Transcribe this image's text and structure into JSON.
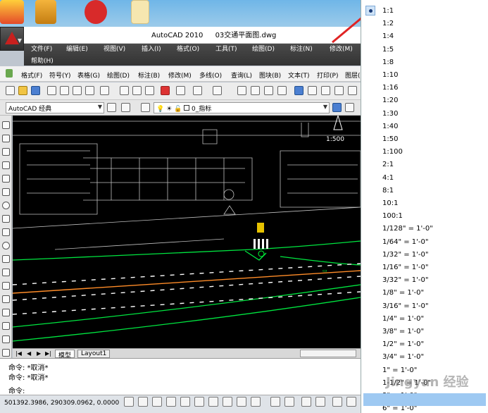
{
  "window": {
    "title": "AutoCAD 2010",
    "document": "03交通平面图.dwg"
  },
  "ribbon_menu": [
    "文件(F)",
    "编辑(E)",
    "视图(V)",
    "插入(I)",
    "格式(O)",
    "工具(T)",
    "绘图(D)",
    "标注(N)",
    "修改(M)",
    "帮助(H)"
  ],
  "classic_menu": [
    "格式(F)",
    "符号(Y)",
    "表格(G)",
    "绘图(D)",
    "标注(B)",
    "修改(M)",
    "多线(O)",
    "查询(L)",
    "图块(B)",
    "文本(T)",
    "打印(P)",
    "图层("
  ],
  "workspace": {
    "name": "AutoCAD 经典",
    "layer": "0_指标"
  },
  "drawing": {
    "scale_label": "1:500"
  },
  "tabs": [
    "模型",
    "Layout1"
  ],
  "command_lines": [
    "命令: *取消*",
    "命令: *取消*",
    "命令:"
  ],
  "status": {
    "coordinates": "501392.3986, 290309.0962, 0.0000"
  },
  "scale_list": {
    "selected": "1:1",
    "items": [
      "1:1",
      "1:2",
      "1:4",
      "1:5",
      "1:8",
      "1:10",
      "1:16",
      "1:20",
      "1:30",
      "1:40",
      "1:50",
      "1:100",
      "2:1",
      "4:1",
      "8:1",
      "10:1",
      "100:1",
      "1/128\" = 1'-0\"",
      "1/64\" = 1'-0\"",
      "1/32\" = 1'-0\"",
      "1/16\" = 1'-0\"",
      "3/32\" = 1'-0\"",
      "1/8\" = 1'-0\"",
      "3/16\" = 1'-0\"",
      "1/4\" = 1'-0\"",
      "3/8\" = 1'-0\"",
      "1/2\" = 1'-0\"",
      "3/4\" = 1'-0\"",
      "1\" = 1'-0\"",
      "1-1/2\" = 1'-0\"",
      "3\" = 1'-0\"",
      "6\" = 1'-0\""
    ]
  },
  "watermark": "Jingyan 经验",
  "colors": {
    "drawing_bg": "#000000",
    "road_line": "#00ff33",
    "center_line": "#ff8c28",
    "accent_arrow": "#e02424",
    "selection": "#9ec9f2"
  }
}
